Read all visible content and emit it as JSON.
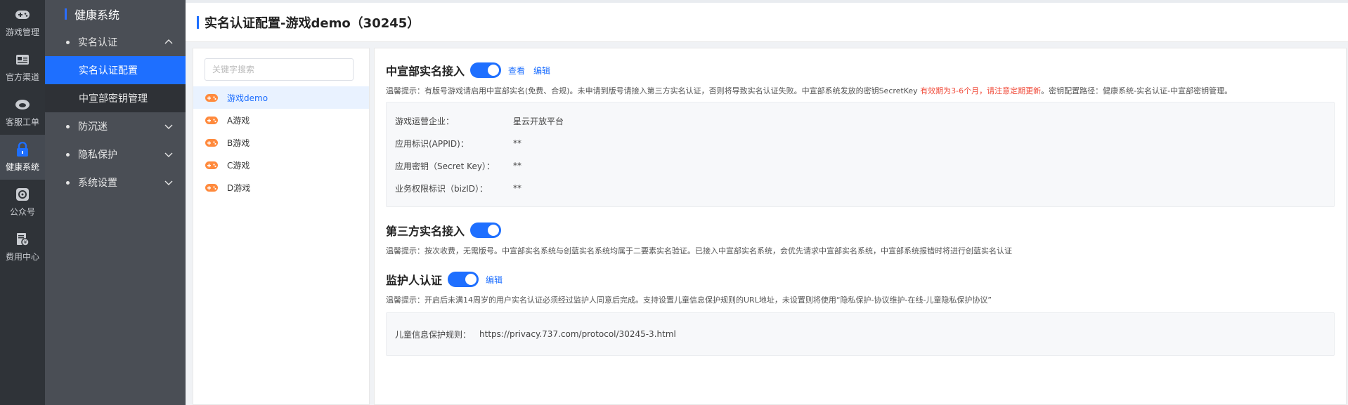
{
  "rail": [
    {
      "label": "游戏管理",
      "icon": "gamepad-icon"
    },
    {
      "label": "官方渠道",
      "icon": "id-card-icon"
    },
    {
      "label": "客服工单",
      "icon": "headset-icon"
    },
    {
      "label": "健康系统",
      "icon": "lock-icon",
      "active": true
    },
    {
      "label": "公众号",
      "icon": "wechat-icon"
    },
    {
      "label": "费用中心",
      "icon": "bill-icon"
    }
  ],
  "menu": {
    "title": "健康系统",
    "groups": [
      {
        "label": "实名认证",
        "expanded": true
      },
      {
        "label": "防沉迷"
      },
      {
        "label": "隐私保护"
      },
      {
        "label": "系统设置"
      }
    ],
    "sub": [
      "实名认证配置",
      "中宣部密钥管理"
    ]
  },
  "page": {
    "title": "实名认证配置-游戏demo（30245）"
  },
  "games": {
    "search_placeholder": "关键字搜索",
    "items": [
      "游戏demo",
      "A游戏",
      "B游戏",
      "C游戏",
      "D游戏"
    ]
  },
  "sections": {
    "zxb": {
      "title": "中宣部实名接入",
      "view": "查看",
      "edit": "编辑",
      "tip_a": "温馨提示：有版号游戏请启用中宣部实名(免费、合规)。未申请到版号请接入第三方实名认证，否则将导致实名认证失败。中宣部系统发放的密钥SecretKey ",
      "tip_red": "有效期为3-6个月，请注意定期更新",
      "tip_b": "。密钥配置路径：健康系统-实名认证-中宣部密钥管理。",
      "rows": [
        {
          "k": "游戏运营企业：",
          "v": "星云开放平台"
        },
        {
          "k": "应用标识(APPID)：",
          "v": "**"
        },
        {
          "k": "应用密钥（Secret Key）：",
          "v": "**"
        },
        {
          "k": "业务权限标识（bizID）：",
          "v": "**"
        }
      ]
    },
    "third": {
      "title": "第三方实名接入",
      "tip": "温馨提示：按次收费，无需版号。中宣部实名系统与创蓝实名系统均属于二要素实名验证。已接入中宣部实名系统，会优先请求中宣部实名系统，中宣部系统报错时将进行创蓝实名认证"
    },
    "guardian": {
      "title": "监护人认证",
      "edit": "编辑",
      "tip": "温馨提示：开启后未满14周岁的用户实名认证必须经过监护人同意后完成。支持设置儿童信息保护规则的URL地址，未设置则将使用“隐私保护-协议维护-在线-儿童隐私保护协议”",
      "rule_label": "儿童信息保护规则：",
      "rule_url": "https://privacy.737.com/protocol/30245-3.html"
    }
  },
  "colors": {
    "accent": "#1e6fff",
    "warn": "#f04b3a",
    "rail_bg": "#2f3338",
    "menu_bg": "#4a4e55"
  }
}
